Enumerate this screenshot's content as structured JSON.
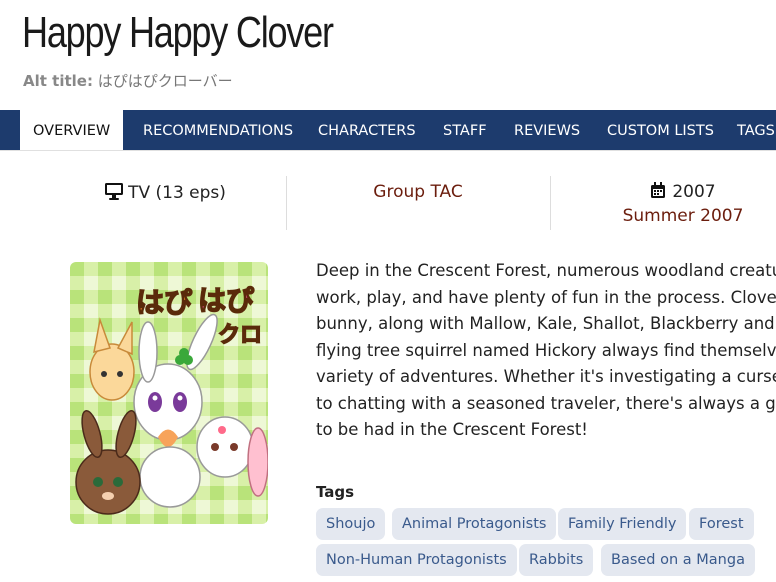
{
  "title": "Happy Happy Clover",
  "alt_title": {
    "label": "Alt title:",
    "value": "はぴはぴクローバー"
  },
  "tabs": [
    {
      "label": "OVERVIEW",
      "active": true
    },
    {
      "label": "RECOMMENDATIONS"
    },
    {
      "label": "CHARACTERS"
    },
    {
      "label": "STAFF"
    },
    {
      "label": "REVIEWS"
    },
    {
      "label": "CUSTOM LISTS"
    },
    {
      "label": "TAGS"
    }
  ],
  "stats": {
    "format": "TV (13 eps)",
    "studio": "Group TAC",
    "year": "2007",
    "season": "Summer 2007"
  },
  "cover": {
    "logo_text_1": "はぴ",
    "logo_text_2": "はぴ",
    "logo_text_3": "クロ"
  },
  "synopsis_lines": [
    "Deep in the Crescent Forest, numerous woodland creatur",
    "work, play, and have plenty of fun in the process. Clover t",
    "bunny, along with Mallow, Kale, Shallot, Blackberry and e",
    "flying tree squirrel named Hickory always find themselves",
    "variety of adventures. Whether it's investigating a cursed",
    "to chatting with a seasoned traveler, there's always a goo",
    "to be had in the Crescent Forest!"
  ],
  "tags_label": "Tags",
  "tags": [
    "Shoujo",
    "Animal Protagonists",
    "Family Friendly",
    "Forest",
    "Non-Human Protagonists",
    "Rabbits",
    "Based on a Manga"
  ],
  "colors": {
    "nav_bg": "#1d3b6d",
    "studio_color": "#6b1d0d",
    "tag_bg": "#e4e8f0",
    "tag_text": "#3a5a8c"
  },
  "icons": {
    "format": "monitor-icon",
    "year": "calendar-icon"
  }
}
